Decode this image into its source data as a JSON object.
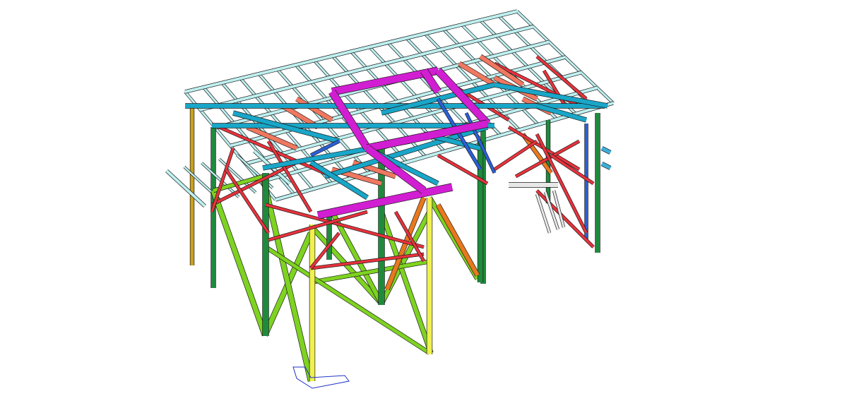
{
  "viewport": {
    "background": "#ffffff",
    "projection": "isometric",
    "render_mode": "shaded-outline"
  },
  "structure": {
    "type": "steel-frame",
    "member_groups": [
      {
        "name": "roof-purlins",
        "color": "#bff0f0"
      },
      {
        "name": "roof-girders",
        "color": "#19a6c8"
      },
      {
        "name": "secondary-girders",
        "color": "#3bb0d9"
      },
      {
        "name": "opening-trim",
        "color": "#d21ed2"
      },
      {
        "name": "columns-main",
        "color": "#1e8a3c"
      },
      {
        "name": "columns-alt",
        "color": "#c8a11e"
      },
      {
        "name": "bracing-green",
        "color": "#7ed321"
      },
      {
        "name": "bracing-red",
        "color": "#e8323c"
      },
      {
        "name": "bracing-salmon",
        "color": "#f07860"
      },
      {
        "name": "bracing-orange",
        "color": "#e8781e"
      },
      {
        "name": "bracing-yellow",
        "color": "#f0f050"
      },
      {
        "name": "bracing-blue",
        "color": "#2b5fd9"
      },
      {
        "name": "ladder",
        "color": "#e8e8e8"
      },
      {
        "name": "base-plate",
        "color": "#1e32c8"
      }
    ]
  }
}
